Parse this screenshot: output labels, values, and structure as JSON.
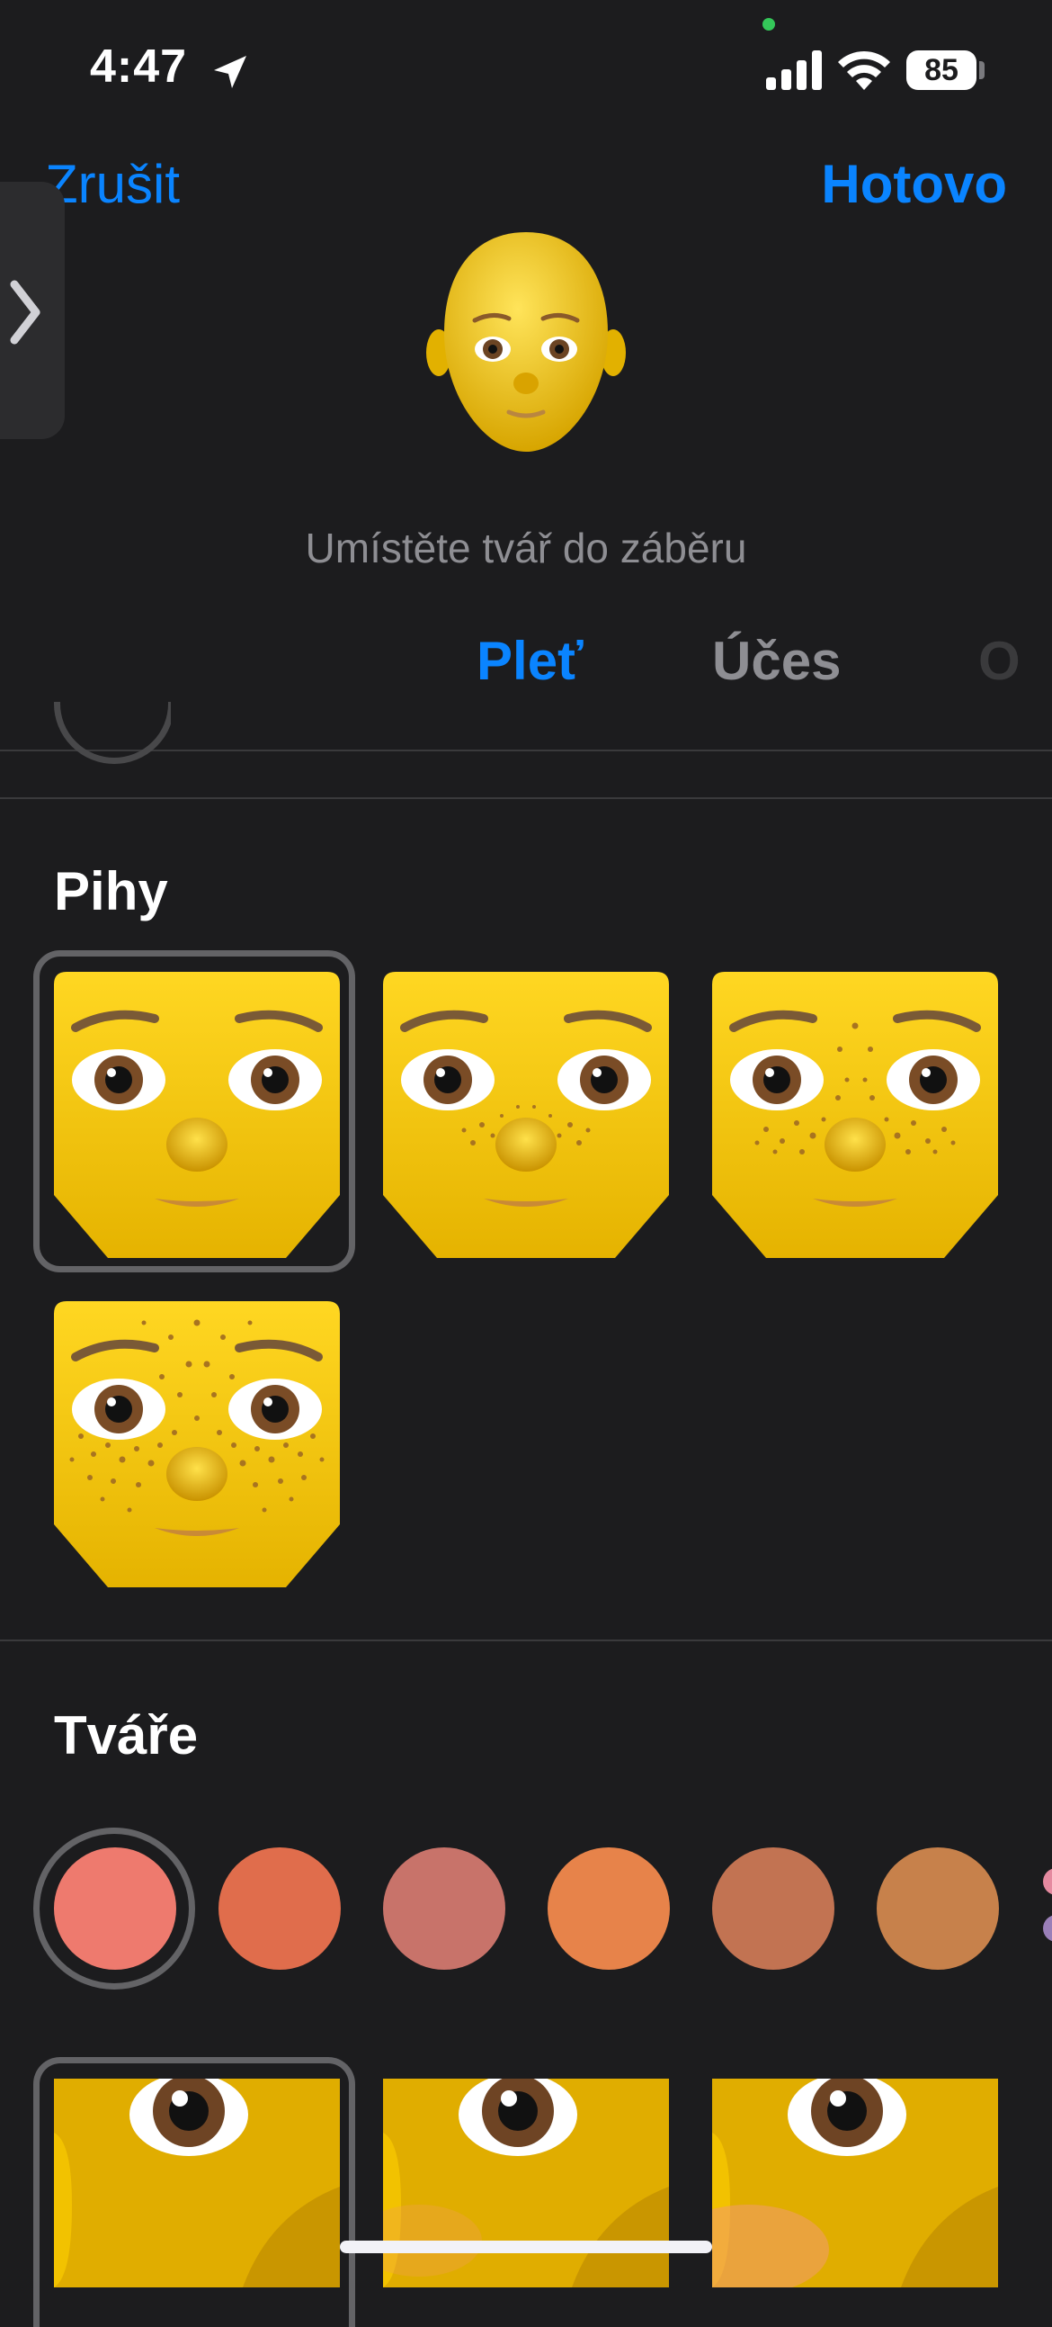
{
  "status_bar": {
    "time": "4:47",
    "battery": "85"
  },
  "nav": {
    "cancel_label": "Zrušit",
    "done_label": "Hotovo"
  },
  "preview": {
    "hint": "Umístěte tvář do záběru"
  },
  "tabs": [
    {
      "label": "Pleť",
      "selected": true
    },
    {
      "label": "Účes",
      "selected": false
    },
    {
      "label": "O",
      "selected": false
    }
  ],
  "freckles": {
    "title": "Pihy",
    "options": [
      {
        "name": "none",
        "selected": true
      },
      {
        "name": "light",
        "selected": false
      },
      {
        "name": "medium",
        "selected": false
      },
      {
        "name": "heavy",
        "selected": false
      }
    ]
  },
  "cheeks": {
    "title": "Tváře",
    "colors": [
      "#ee7a6e",
      "#e06d4c",
      "#c8736a",
      "#e7834a",
      "#c27352",
      "#c7814b"
    ],
    "selected_index": 0
  },
  "colors": {
    "accent": "#0a84ff",
    "background": "#1c1c1e",
    "secondary_text": "#8e8e93"
  }
}
